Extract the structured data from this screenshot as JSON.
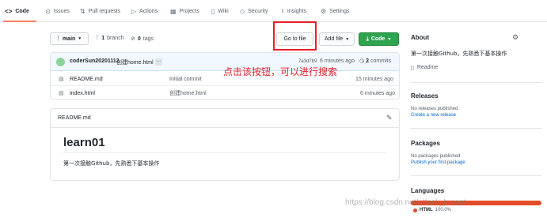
{
  "nav": {
    "tabs": [
      {
        "label": "Code",
        "icon": "code-icon"
      },
      {
        "label": "Issues",
        "icon": "issue-icon"
      },
      {
        "label": "Pull requests",
        "icon": "pull-request-icon"
      },
      {
        "label": "Actions",
        "icon": "play-icon"
      },
      {
        "label": "Projects",
        "icon": "project-icon"
      },
      {
        "label": "Wiki",
        "icon": "book-icon"
      },
      {
        "label": "Security",
        "icon": "shield-icon"
      },
      {
        "label": "Insights",
        "icon": "graph-icon"
      },
      {
        "label": "Settings",
        "icon": "gear-icon"
      }
    ],
    "selected": "Code"
  },
  "toolbar": {
    "branch": "main",
    "branch_count": "1",
    "branch_label": "branch",
    "tags_count": "0",
    "tags_label": "tags",
    "go_to_file": "Go to file",
    "add_file": "Add file",
    "code": "Code"
  },
  "commit": {
    "author": "coderSun20201112",
    "message": "创建home.html",
    "ellipsis": "...",
    "hash": "7a3d7b9",
    "time": "6 minutes ago",
    "commit_count": "2",
    "commit_label": "commits"
  },
  "files": [
    {
      "name": "README.md",
      "message": "Initial commit",
      "age": "15 minutes ago"
    },
    {
      "name": "index.html",
      "message": "创建home.html",
      "age": "6 minutes ago"
    }
  ],
  "readme": {
    "filename": "README.md",
    "heading": "learn01",
    "body": "第一次接触Github，先熟悉下基本操作"
  },
  "sidebar": {
    "about_title": "About",
    "description": "第一次接触Github，先熟悉下基本操作",
    "readme_link": "Readme",
    "releases_title": "Releases",
    "releases_empty": "No releases published",
    "releases_link": "Create a new release",
    "packages_title": "Packages",
    "packages_empty": "No packages published",
    "packages_link": "Publish your first package",
    "languages_title": "Languages",
    "language_name": "HTML",
    "language_percent": "100.0%",
    "language_color": "#e34c26"
  },
  "annotation": {
    "text": "点击该按钮，可以进行搜索"
  },
  "watermark": "https://blog.csdn.net/attack_breast"
}
